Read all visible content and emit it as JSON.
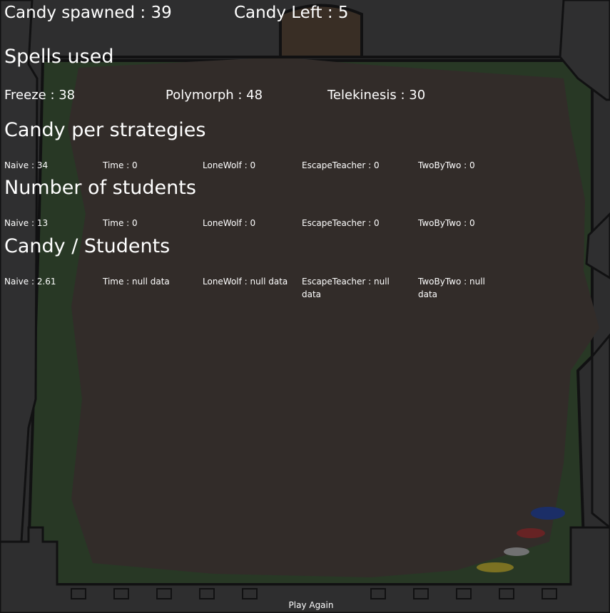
{
  "header": {
    "candy_spawned": "Candy spawned : 39",
    "candy_left": "Candy Left : 5"
  },
  "spells": {
    "title": "Spells used",
    "items": [
      "Freeze : 38",
      "Polymorph : 48",
      "Telekinesis : 30"
    ]
  },
  "candy_per_strategy": {
    "title": "Candy per strategies",
    "items": [
      "Naive : 34",
      "Time : 0",
      "LoneWolf : 0",
      "EscapeTeacher : 0",
      "TwoByTwo : 0"
    ]
  },
  "students": {
    "title": "Number of students",
    "items": [
      "Naive : 13",
      "Time : 0",
      "LoneWolf : 0",
      "EscapeTeacher : 0",
      "TwoByTwo : 0"
    ]
  },
  "candy_per_student": {
    "title": "Candy / Students",
    "items": [
      "Naive : 2.61",
      "Time : null data",
      "LoneWolf : null data",
      "EscapeTeacher : null data",
      "TwoByTwo : null data"
    ]
  },
  "play_again": "Play Again",
  "colors": {
    "wall": "#3a3a3a",
    "grass": "#2f4a2a",
    "dirt": "#3e3632",
    "text": "#ffffff"
  }
}
